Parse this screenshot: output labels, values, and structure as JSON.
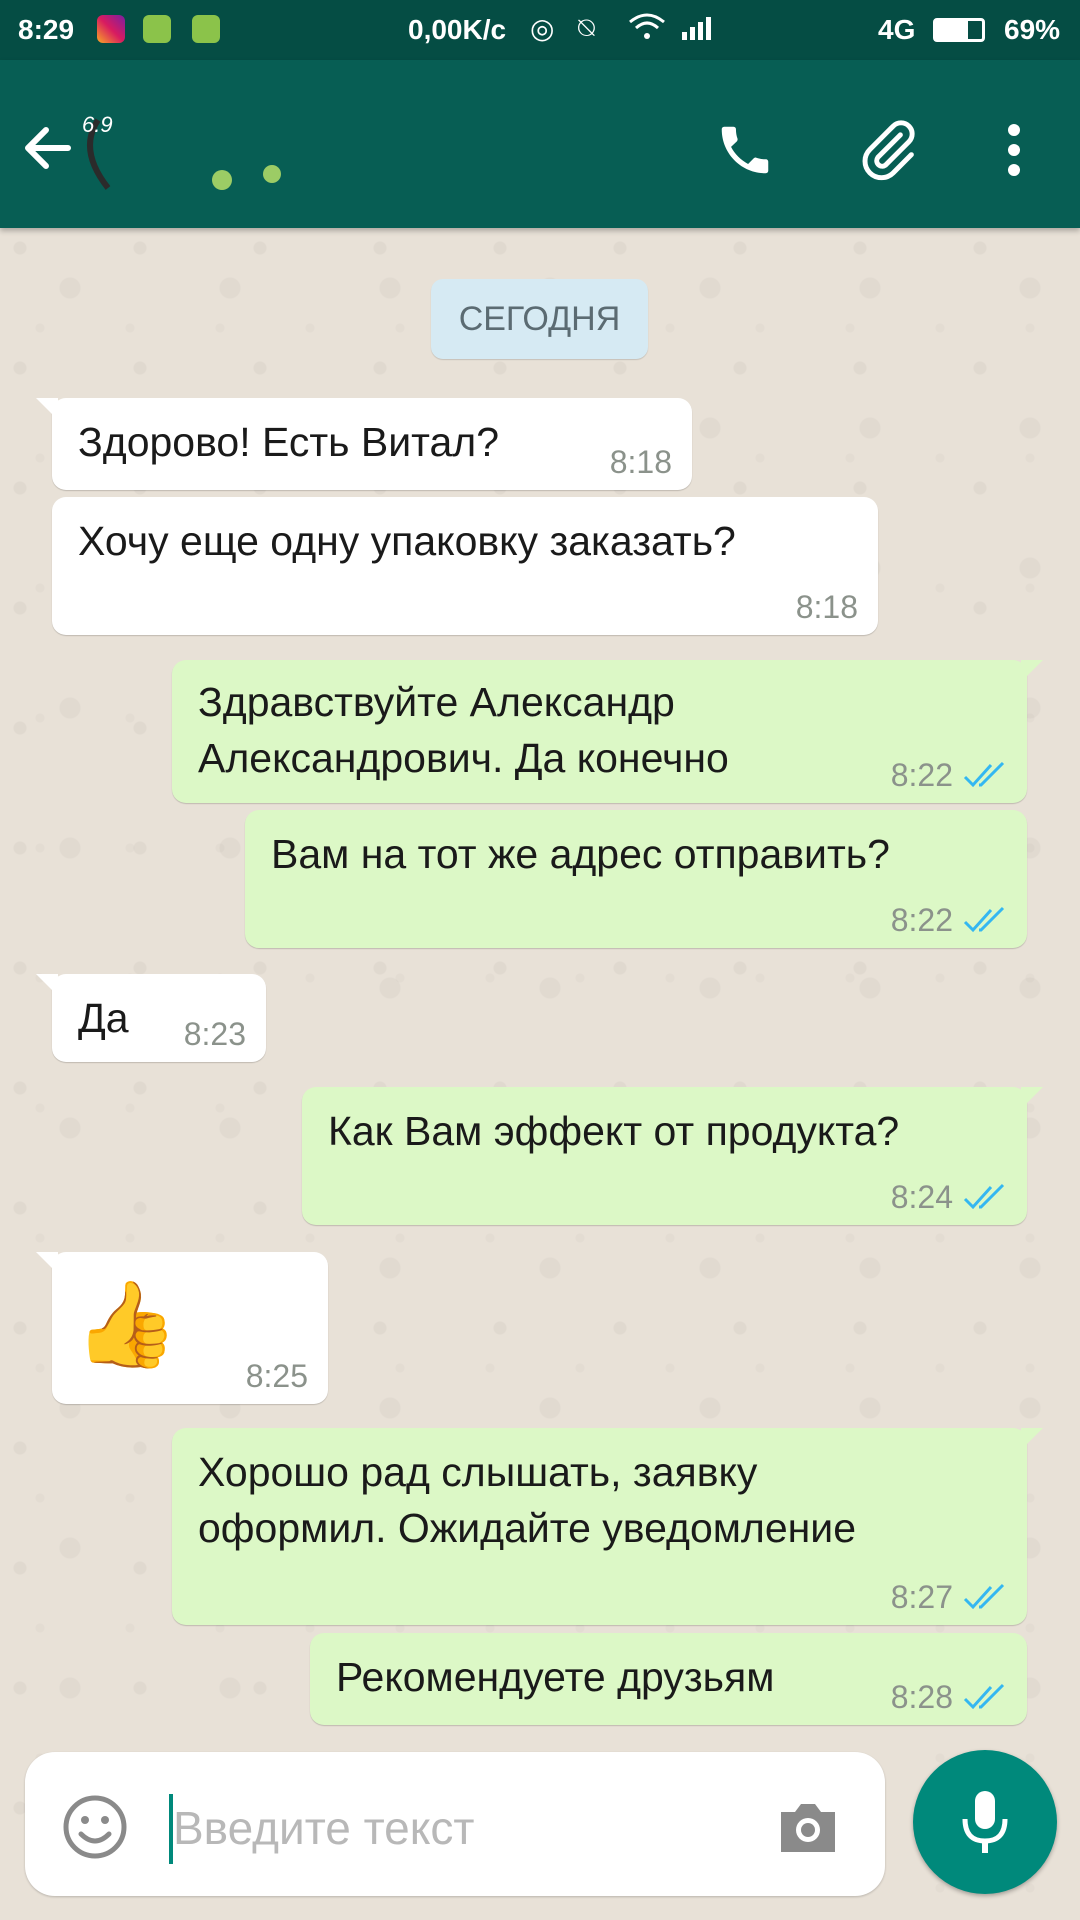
{
  "status_bar": {
    "time": "8:29",
    "speed": "0,00K/c",
    "network": "4G",
    "battery": "69%",
    "battery_level": 0.69
  },
  "header": {
    "contact_name": "6.9"
  },
  "date_chip": "СЕГОДНЯ",
  "messages": [
    {
      "direction": "in",
      "text": "Здорово! Есть Витал?",
      "time": "8:18"
    },
    {
      "direction": "in",
      "text": "Хочу еще одну упаковку заказать?",
      "time": "8:18"
    },
    {
      "direction": "out",
      "lines": [
        "Здравствуйте Александр",
        "Александрович. Да конечно"
      ],
      "time": "8:22",
      "status": "read"
    },
    {
      "direction": "out",
      "text": "Вам на тот же адрес отправить?",
      "time": "8:22",
      "status": "read"
    },
    {
      "direction": "in",
      "text": "Да",
      "time": "8:23"
    },
    {
      "direction": "out",
      "text": "Как Вам эффект от продукта?",
      "time": "8:24",
      "status": "read"
    },
    {
      "direction": "in",
      "text": "👍",
      "time": "8:25"
    },
    {
      "direction": "out",
      "lines": [
        "Хорошо рад слышать, заявку",
        "оформил. Ожидайте уведомление"
      ],
      "time": "8:27",
      "status": "read"
    },
    {
      "direction": "out",
      "text": "Рекомендуете друзьям",
      "time": "8:28",
      "status": "read"
    }
  ],
  "composer": {
    "placeholder": "Введите текст"
  },
  "colors": {
    "status_bar": "#054d44",
    "top_bar": "#075e54",
    "outgoing_bubble": "#dcf8c6",
    "incoming_bubble": "#ffffff",
    "accent": "#00897b",
    "read_tick": "#34b7f1"
  },
  "icons": [
    "instagram-icon",
    "notification-app-icon",
    "alarm-icon",
    "mute-icon",
    "wifi-icon",
    "signal-icon",
    "back-arrow-icon",
    "phone-icon",
    "paperclip-icon",
    "more-vert-icon",
    "emoji-icon",
    "camera-icon",
    "microphone-icon",
    "double-check-icon"
  ]
}
